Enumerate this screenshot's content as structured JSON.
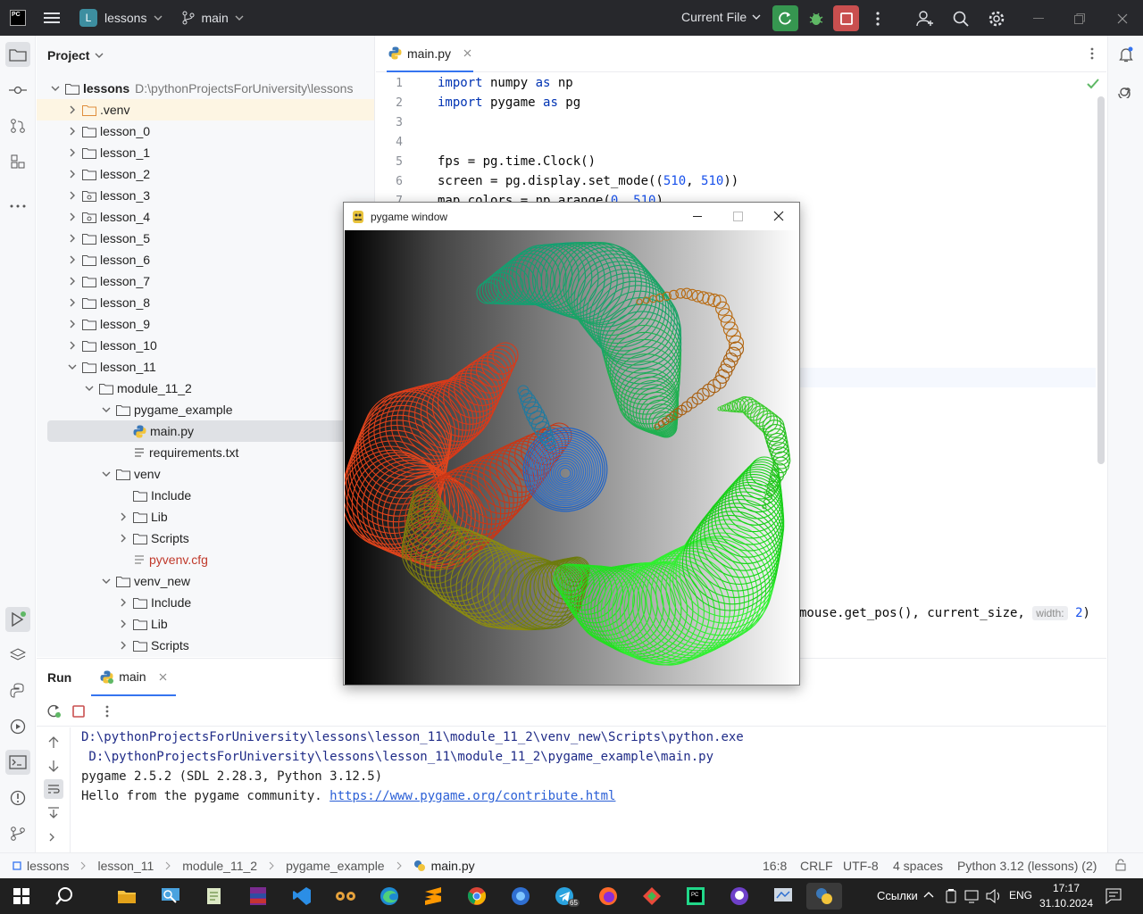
{
  "titlebar": {
    "logo": "PC",
    "project_badge": "L",
    "project_name": "lessons",
    "branch": "main",
    "run_config": "Current File"
  },
  "project_panel": {
    "title": "Project",
    "root_name": "lessons",
    "root_path": "D:\\pythonProjectsForUniversity\\lessons",
    "items": [
      {
        "label": ".venv"
      },
      {
        "label": "lesson_0"
      },
      {
        "label": "lesson_1"
      },
      {
        "label": "lesson_2"
      },
      {
        "label": "lesson_3"
      },
      {
        "label": "lesson_4"
      },
      {
        "label": "lesson_5"
      },
      {
        "label": "lesson_6"
      },
      {
        "label": "lesson_7"
      },
      {
        "label": "lesson_8"
      },
      {
        "label": "lesson_9"
      },
      {
        "label": "lesson_10"
      },
      {
        "label": "lesson_11"
      },
      {
        "label": "module_11_2"
      },
      {
        "label": "pygame_example"
      },
      {
        "label": "main.py"
      },
      {
        "label": "requirements.txt"
      },
      {
        "label": "venv"
      },
      {
        "label": "Include"
      },
      {
        "label": "Lib"
      },
      {
        "label": "Scripts"
      },
      {
        "label": "pyvenv.cfg"
      },
      {
        "label": "venv_new"
      },
      {
        "label": "Include"
      },
      {
        "label": "Lib"
      },
      {
        "label": "Scripts"
      }
    ]
  },
  "editor": {
    "tab": "main.py",
    "line_numbers": [
      "1",
      "2",
      "3",
      "4",
      "5",
      "6",
      "7"
    ],
    "lines": {
      "l1": {
        "kw1": "import",
        "a": " numpy ",
        "kw2": "as",
        "b": " np"
      },
      "l2": {
        "kw1": "import",
        "a": " pygame ",
        "kw2": "as",
        "b": " pg"
      },
      "l5": "fps = pg.time.Clock()",
      "l6": {
        "a": "screen = pg.display.set_mode((",
        "n1": "510",
        "c": ", ",
        "n2": "510",
        "d": "))"
      },
      "l7": {
        "a": "map_colors = np.arange(",
        "n1": "0",
        "c": ", ",
        "n2": "510",
        "d": ")"
      }
    },
    "line_tail": {
      "a": "mouse.get_pos(), current_size, ",
      "hint": "width:",
      "n": "2",
      "b": ")"
    }
  },
  "pygame_window": {
    "title": "pygame window"
  },
  "run_panel": {
    "title": "Run",
    "tab": "main",
    "output": [
      "D:\\pythonProjectsForUniversity\\lessons\\lesson_11\\module_11_2\\venv_new\\Scripts\\python.exe",
      " D:\\pythonProjectsForUniversity\\lessons\\lesson_11\\module_11_2\\pygame_example\\main.py",
      "pygame 2.5.2 (SDL 2.28.3, Python 3.12.5)",
      "Hello from the pygame community. "
    ],
    "link": "https://www.pygame.org/contribute.html"
  },
  "statusbar": {
    "breadcrumbs": [
      "lessons",
      "lesson_11",
      "module_11_2",
      "pygame_example",
      "main.py"
    ],
    "position": "16:8",
    "line_sep": "CRLF",
    "encoding": "UTF-8",
    "indent": "4 spaces",
    "interpreter": "Python 3.12 (lessons) (2)"
  },
  "taskbar": {
    "tray_links": "Ссылки",
    "lang": "ENG",
    "time": "17:17",
    "date": "31.10.2024",
    "badge": "65"
  },
  "colors": {
    "accent": "#3574f0",
    "titlebar_bg": "#27282c",
    "run_green": "#369650",
    "stop_red": "#c94f4f",
    "folder_orange": "#e08e3c"
  }
}
